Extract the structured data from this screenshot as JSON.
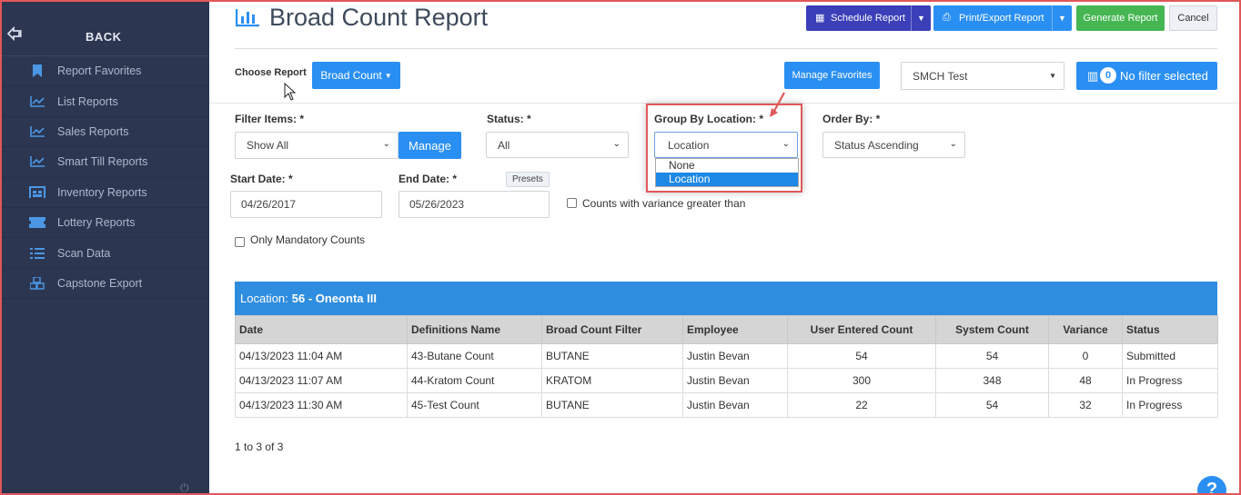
{
  "sidebar": {
    "back_label": "BACK",
    "items": [
      {
        "label": "Report Favorites",
        "icon": "bookmark-icon"
      },
      {
        "label": "List Reports",
        "icon": "line-chart-icon"
      },
      {
        "label": "Sales Reports",
        "icon": "line-chart-icon"
      },
      {
        "label": "Smart Till Reports",
        "icon": "line-chart-icon"
      },
      {
        "label": "Inventory Reports",
        "icon": "warehouse-icon"
      },
      {
        "label": "Lottery Reports",
        "icon": "ticket-icon"
      },
      {
        "label": "Scan Data",
        "icon": "list-icon"
      },
      {
        "label": "Capstone Export",
        "icon": "cubes-icon"
      }
    ]
  },
  "header": {
    "title": "Broad Count Report",
    "schedule_label": "Schedule Report",
    "print_label": "Print/Export Report",
    "generate_label": "Generate Report",
    "cancel_label": "Cancel"
  },
  "toolbar": {
    "choose_report_label": "Choose Report",
    "report_value": "Broad Count",
    "manage_favorites_label": "Manage Favorites",
    "store_value": "SMCH Test",
    "filter_count": "0",
    "filter_label": "No filter selected"
  },
  "filters": {
    "filter_items_label": "Filter Items: *",
    "filter_items_value": "Show All",
    "manage_label": "Manage",
    "status_label": "Status: *",
    "status_value": "All",
    "group_by_label": "Group By Location: *",
    "group_by_value": "Location",
    "group_by_options": [
      "None",
      "Location"
    ],
    "order_by_label": "Order By: *",
    "order_by_value": "Status Ascending",
    "start_date_label": "Start Date: *",
    "start_date_value": "04/26/2017",
    "end_date_label": "End Date: *",
    "end_date_value": "05/26/2023",
    "presets_label": "Presets",
    "variance_label": "Counts with variance greater than",
    "mandatory_label": "Only Mandatory Counts"
  },
  "report": {
    "location_prefix": "Location:",
    "location_value": "56 - Oneonta III",
    "columns": [
      "Date",
      "Definitions Name",
      "Broad Count Filter",
      "Employee",
      "User Entered Count",
      "System Count",
      "Variance",
      "Status"
    ],
    "rows": [
      [
        "04/13/2023 11:04 AM",
        "43-Butane Count",
        "BUTANE",
        "Justin Bevan",
        "54",
        "54",
        "0",
        "Submitted"
      ],
      [
        "04/13/2023 11:07 AM",
        "44-Kratom Count",
        "KRATOM",
        "Justin Bevan",
        "300",
        "348",
        "48",
        "In Progress"
      ],
      [
        "04/13/2023 11:30 AM",
        "45-Test Count",
        "BUTANE",
        "Justin Bevan",
        "22",
        "54",
        "32",
        "In Progress"
      ]
    ],
    "pager": "1 to 3 of 3"
  },
  "help_label": "?",
  "colors": {
    "sidebar": "#2c3650",
    "accent": "#2a8ff2",
    "highlight": "#e0585a"
  }
}
